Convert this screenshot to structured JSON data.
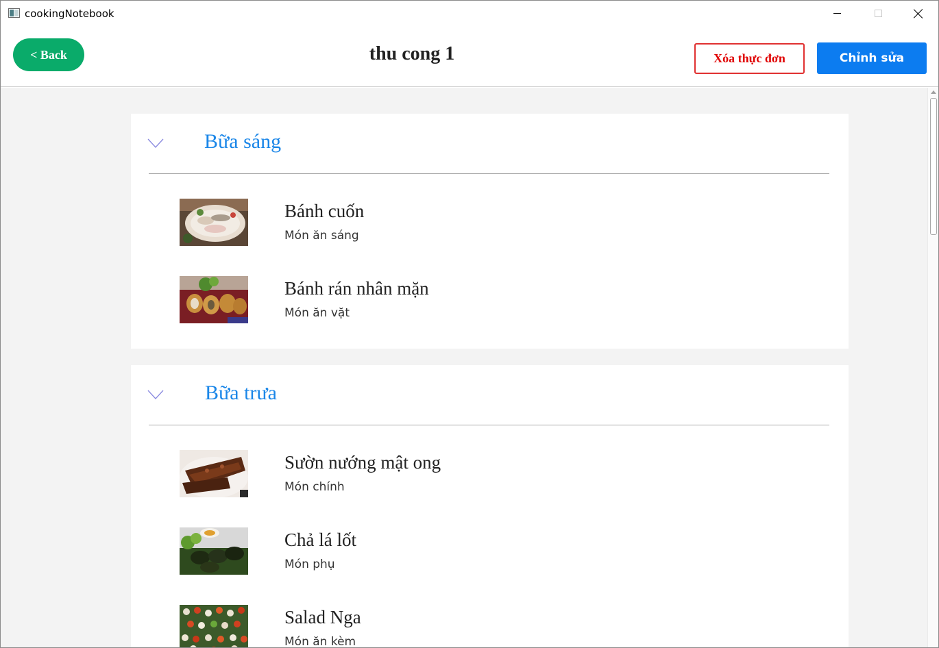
{
  "window": {
    "title": "cookingNotebook"
  },
  "header": {
    "back_label": "< Back",
    "page_title": "thu cong 1",
    "delete_label": "Xóa thực đơn",
    "edit_label": "Chỉnh sửa"
  },
  "sections": [
    {
      "title": "Bữa sáng",
      "dishes": [
        {
          "name": "Bánh cuốn",
          "type": "Món ăn sáng"
        },
        {
          "name": "Bánh rán nhân mặn",
          "type": "Món ăn vặt"
        }
      ]
    },
    {
      "title": "Bữa trưa",
      "dishes": [
        {
          "name": "Sườn nướng mật ong",
          "type": "Món chính"
        },
        {
          "name": "Chả lá lốt",
          "type": "Món phụ"
        },
        {
          "name": "Salad Nga",
          "type": "Món ăn kèm"
        }
      ]
    }
  ],
  "colors": {
    "back_button": "#0aab6a",
    "edit_button": "#0c7cf0",
    "delete_button": "#e00000",
    "section_title": "#1a86e8",
    "content_background": "#f3f3f3"
  },
  "icons": [
    "app-icon",
    "minimize-icon",
    "maximize-icon",
    "close-icon",
    "chevron-down-icon"
  ]
}
